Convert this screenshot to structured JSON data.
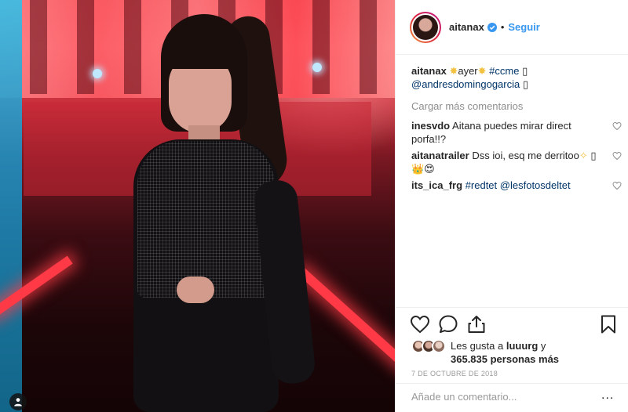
{
  "post": {
    "photo_alt": "aitanax post photo",
    "username": "aitanax",
    "follow_label": "Seguir",
    "separator": "•"
  },
  "caption": {
    "username": "aitanax",
    "text_before": "ayer",
    "hashtag": "#ccme",
    "glyph1": "▯",
    "mention": "@andresdomingogarcia",
    "glyph2": "▯"
  },
  "load_more_label": "Cargar más comentarios",
  "comments": [
    {
      "username": "inesvdo",
      "text": "Aitana puedes mirar direct porfa!!?"
    },
    {
      "username": "aitanatrailer",
      "text": "Dss ioi, esq me derritoo",
      "trail": "▯",
      "second_line": "👑😍"
    },
    {
      "username": "its_ica_frg",
      "tag1": "#redtet",
      "tag2": "@lesfotosdeltet"
    }
  ],
  "likes": {
    "prefix": "Les gusta a",
    "liker": "luuurg",
    "connector": "y",
    "count_text": "365.835 personas más"
  },
  "date": "7 de octubre de 2018",
  "add_comment": {
    "placeholder": "Añade un comentario...",
    "more_label": "..."
  },
  "icons": {
    "verified": "verified-badge-icon",
    "heart": "heart-icon",
    "comment": "comment-icon",
    "share": "share-icon",
    "bookmark": "bookmark-icon",
    "user_tag": "user-tag-icon"
  },
  "colors": {
    "link_blue": "#3897f0",
    "tag_navy": "#003569",
    "muted_gray": "#8e8e8e"
  }
}
